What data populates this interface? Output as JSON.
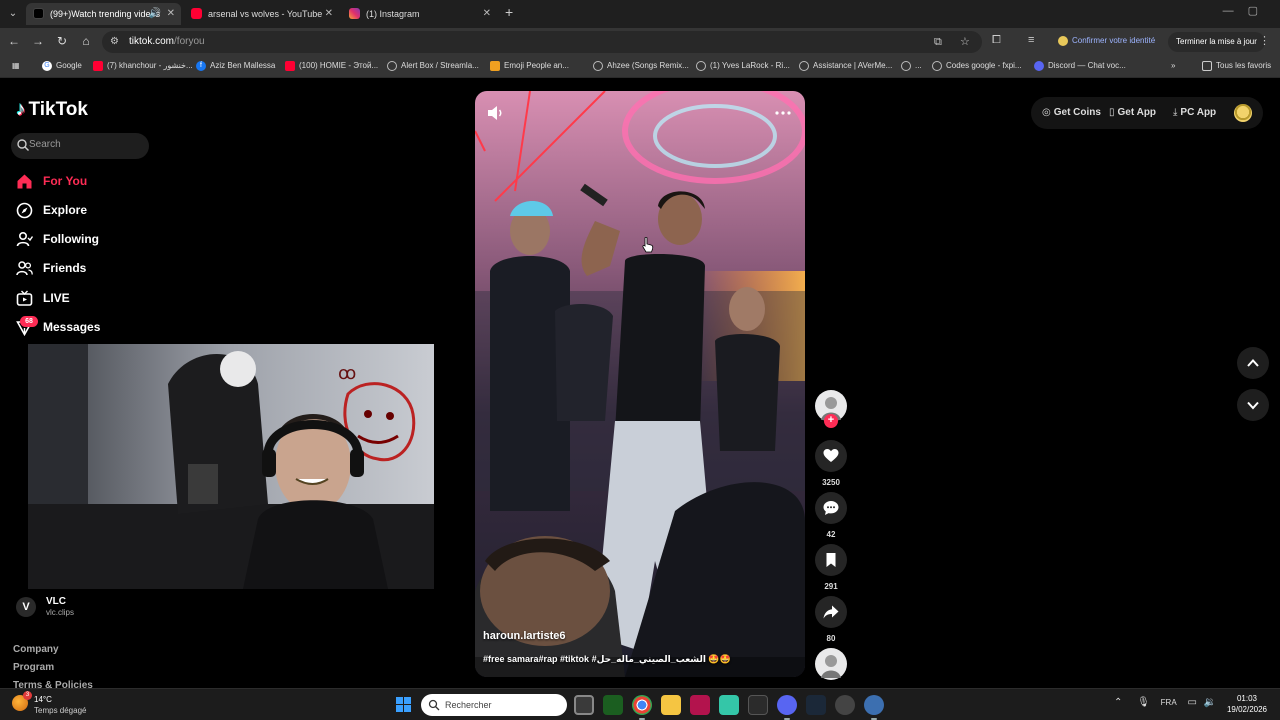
{
  "browser": {
    "tabs": [
      {
        "title": "(99+)Watch trending videos",
        "active": true
      },
      {
        "title": "arsenal vs wolves - YouTube",
        "active": false
      },
      {
        "title": "(1) Instagram",
        "active": false
      }
    ],
    "url_host": "tiktok.com",
    "url_path": "/foryou",
    "identity_label": "Confirmer votre identité",
    "finish_update_label": "Terminer la mise à jour",
    "bookmarks": [
      "Google",
      "(7) khanchour - خنشور...",
      "Aziz Ben Mallessa",
      "(100) HOMIE - Этой...",
      "Alert Box / Streamla...",
      "Emoji People an...",
      "Ahzee (Songs Remix...",
      "(1) Yves LaRock - Ri...",
      "Assistance | AVerMe...",
      "...",
      "Codes google - fxpi...",
      "Discord — Chat voc..."
    ],
    "all_bookmarks_label": "Tous les favoris"
  },
  "tiktok": {
    "logo_text": "TikTok",
    "search_placeholder": "Search",
    "nav": [
      {
        "label": "For You",
        "icon": "home-icon",
        "active": true
      },
      {
        "label": "Explore",
        "icon": "compass-icon",
        "active": false
      },
      {
        "label": "Following",
        "icon": "following-icon",
        "active": false
      },
      {
        "label": "Friends",
        "icon": "friends-icon",
        "active": false
      },
      {
        "label": "LIVE",
        "icon": "live-tv-icon",
        "active": false
      },
      {
        "label": "Messages",
        "icon": "messages-icon",
        "active": false,
        "badge": "68"
      }
    ],
    "following_account": {
      "name": "VLC",
      "handle": "vlc.clips",
      "avatar_letter": "V"
    },
    "footer_links": [
      "Company",
      "Program",
      "Terms & Policies"
    ],
    "top_right": {
      "get_coins": "Get Coins",
      "get_app": "Get App",
      "pc_app": "PC App"
    },
    "video": {
      "author": "haroun.lartiste6",
      "caption": "#free samara#rap #tiktok #الشعب_الصيني_ماله_حل 🤩🤩",
      "likes": "3250",
      "comments": "42",
      "saves": "291",
      "shares": "80"
    },
    "colors": {
      "accent": "#fe2c55",
      "cyan": "#25f4ee"
    }
  },
  "taskbar": {
    "weather_temp": "14°C",
    "weather_condition": "Temps dégagé",
    "weather_badge": "3",
    "search_placeholder": "Rechercher",
    "language": "FRA",
    "time": "01:03",
    "date": "19/02/2026"
  }
}
